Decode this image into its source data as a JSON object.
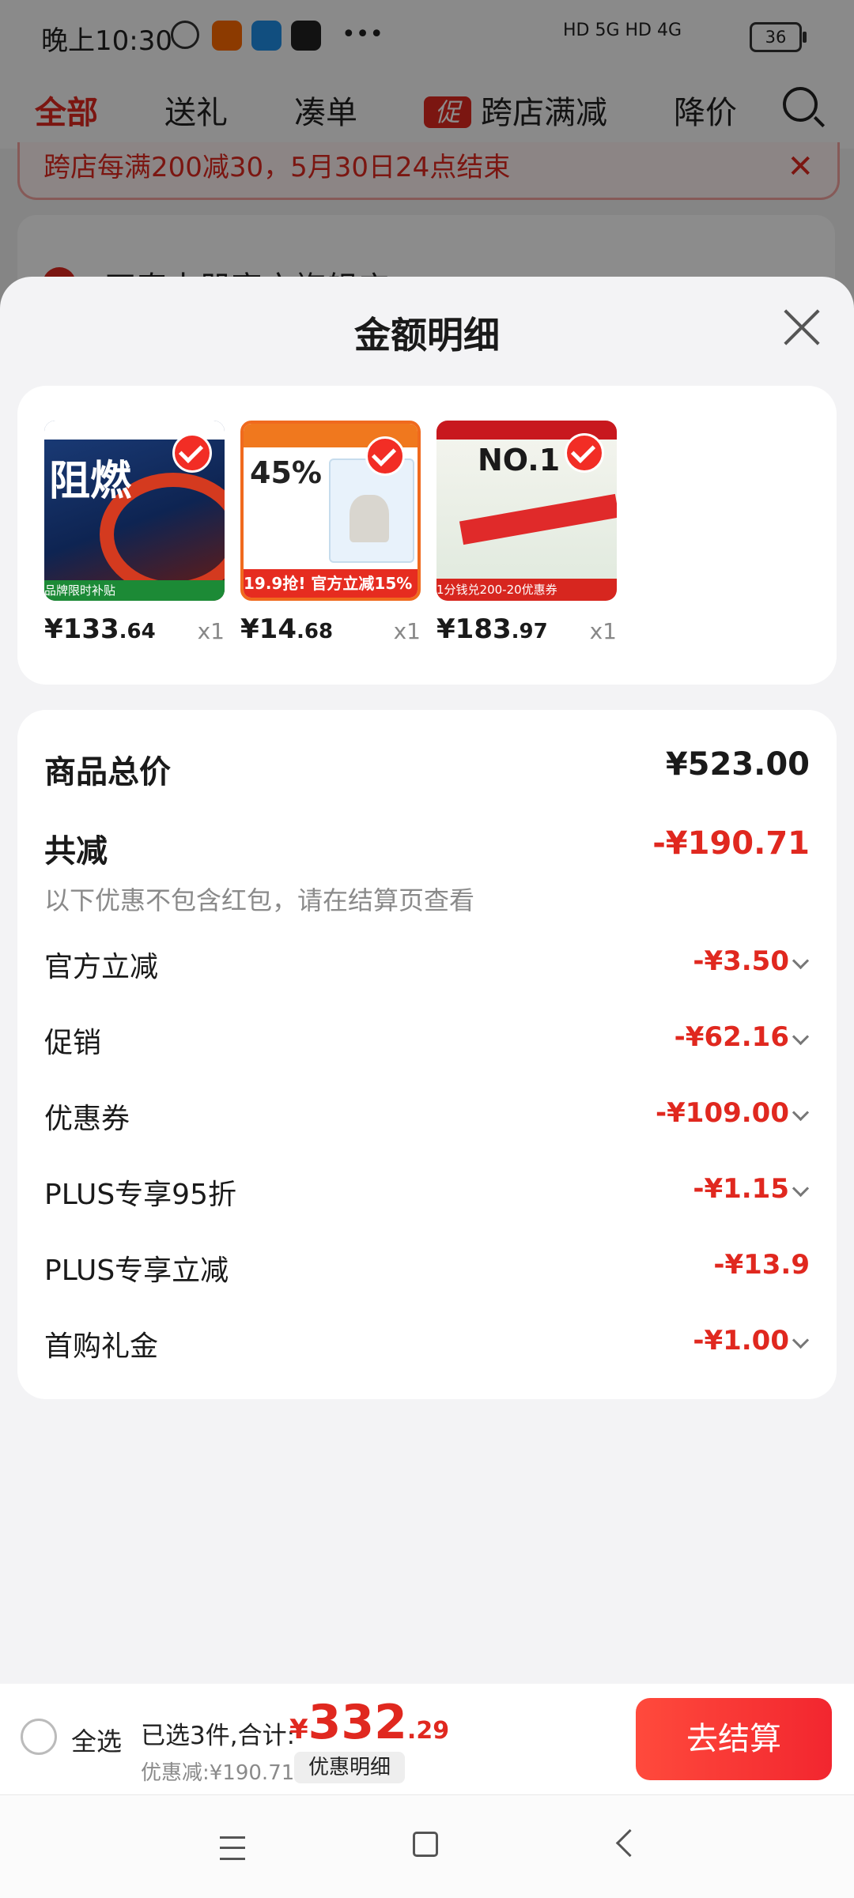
{
  "status_bar": {
    "time": "晚上10:30",
    "right_text": "HD 5G  HD 4G",
    "battery": "36"
  },
  "tabs": [
    {
      "label": "全部"
    },
    {
      "label": "送礼"
    },
    {
      "label": "凑单"
    },
    {
      "label": "跨店满减",
      "badge": "促"
    },
    {
      "label": "降价"
    }
  ],
  "banner": {
    "text": "跨店每满200减30，5月30日24点结束"
  },
  "store": {
    "name": "正泰电器官方旗舰店"
  },
  "sheet": {
    "title": "金额明细",
    "products": [
      {
        "price_int": "¥133",
        "price_dec": ".64",
        "qty": "x1",
        "thumb_text": "阻燃",
        "thumb_footer": "品牌限时补贴"
      },
      {
        "price_int": "¥14",
        "price_dec": ".68",
        "qty": "x1",
        "thumb_text": "45%",
        "thumb_footer": "19.9抢! 官方立减15%"
      },
      {
        "price_int": "¥183",
        "price_dec": ".97",
        "qty": "x1",
        "thumb_text": "NO.1",
        "thumb_footer": "1分钱兑200-20优惠券"
      }
    ],
    "summary": {
      "total_label": "商品总价",
      "total_value": "¥523.00",
      "reduce_label": "共减",
      "reduce_value": "-¥190.71",
      "note": "以下优惠不包含红包，请在结算页查看",
      "rows": [
        {
          "label": "官方立减",
          "value": "-¥3.50"
        },
        {
          "label": "促销",
          "value": "-¥62.16"
        },
        {
          "label": "优惠券",
          "value": "-¥109.00"
        },
        {
          "label": "PLUS专享95折",
          "value": "-¥1.15"
        },
        {
          "label": "PLUS专享立减",
          "value": "-¥13.9"
        },
        {
          "label": "首购礼金",
          "value": "-¥1.00"
        }
      ]
    }
  },
  "bottom_bar": {
    "select_all": "全选",
    "selected_text": "已选3件,合计:",
    "total_currency": "¥",
    "total_int": "332",
    "total_dec": ".29",
    "discount_text": "优惠减:¥190.71",
    "detail_button": "优惠明细",
    "checkout_button": "去结算"
  },
  "colors": {
    "accent": "#e0281f",
    "checkout": "#f2262f"
  }
}
